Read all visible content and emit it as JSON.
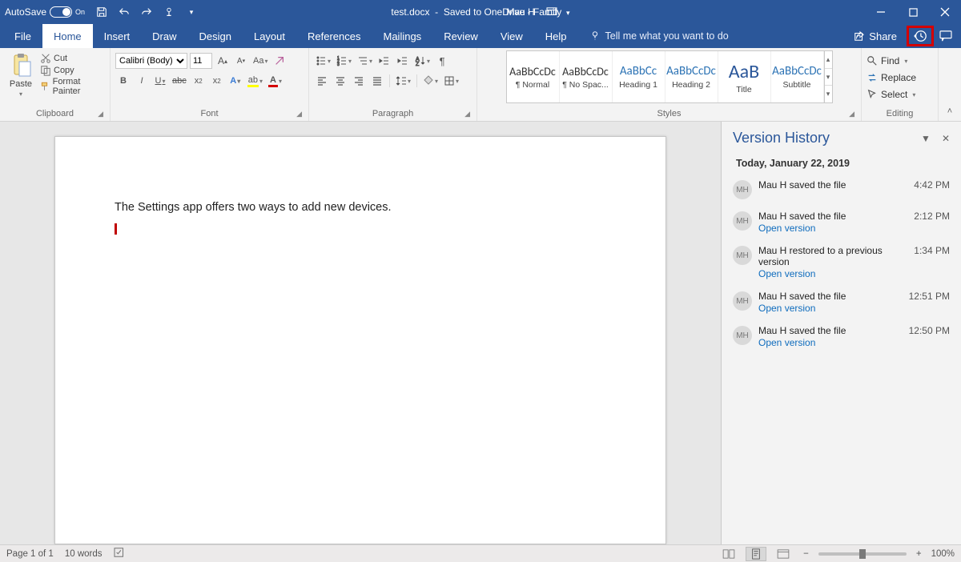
{
  "titlebar": {
    "autosave_label": "AutoSave",
    "autosave_state": "On",
    "doc_name": "test.docx",
    "saved_location": "Saved to OneDrive - Family",
    "user_name": "Mau H"
  },
  "tabs": {
    "file": "File",
    "home": "Home",
    "insert": "Insert",
    "draw": "Draw",
    "design": "Design",
    "layout": "Layout",
    "references": "References",
    "mailings": "Mailings",
    "review": "Review",
    "view": "View",
    "help": "Help",
    "tell_me": "Tell me what you want to do",
    "share": "Share"
  },
  "clipboard": {
    "paste": "Paste",
    "cut": "Cut",
    "copy": "Copy",
    "format_painter": "Format Painter",
    "group_label": "Clipboard"
  },
  "font": {
    "name": "Calibri (Body)",
    "size": "11",
    "group_label": "Font"
  },
  "paragraph": {
    "group_label": "Paragraph"
  },
  "styles": {
    "group_label": "Styles",
    "preview_text": "AaBbCcDc",
    "preview_text_short": "AaBbCc",
    "preview_text_big": "AaB",
    "items": [
      "¶ Normal",
      "¶ No Spac...",
      "Heading 1",
      "Heading 2",
      "Title",
      "Subtitle"
    ]
  },
  "editing": {
    "find": "Find",
    "replace": "Replace",
    "select": "Select",
    "group_label": "Editing"
  },
  "document": {
    "body_text": "The Settings app offers two ways to add new devices."
  },
  "version_panel": {
    "title": "Version History",
    "date_header": "Today, January 22, 2019",
    "avatar_initials": "MH",
    "open_link": "Open version",
    "entries": [
      {
        "text": "Mau H saved the file",
        "time": "4:42 PM",
        "link": false
      },
      {
        "text": "Mau H saved the file",
        "time": "2:12 PM",
        "link": true
      },
      {
        "text": "Mau H restored to a previous version",
        "time": "1:34 PM",
        "link": true
      },
      {
        "text": "Mau H saved the file",
        "time": "12:51 PM",
        "link": true
      },
      {
        "text": "Mau H saved the file",
        "time": "12:50 PM",
        "link": true
      }
    ]
  },
  "statusbar": {
    "page": "Page 1 of 1",
    "words": "10 words",
    "zoom": "100%"
  }
}
